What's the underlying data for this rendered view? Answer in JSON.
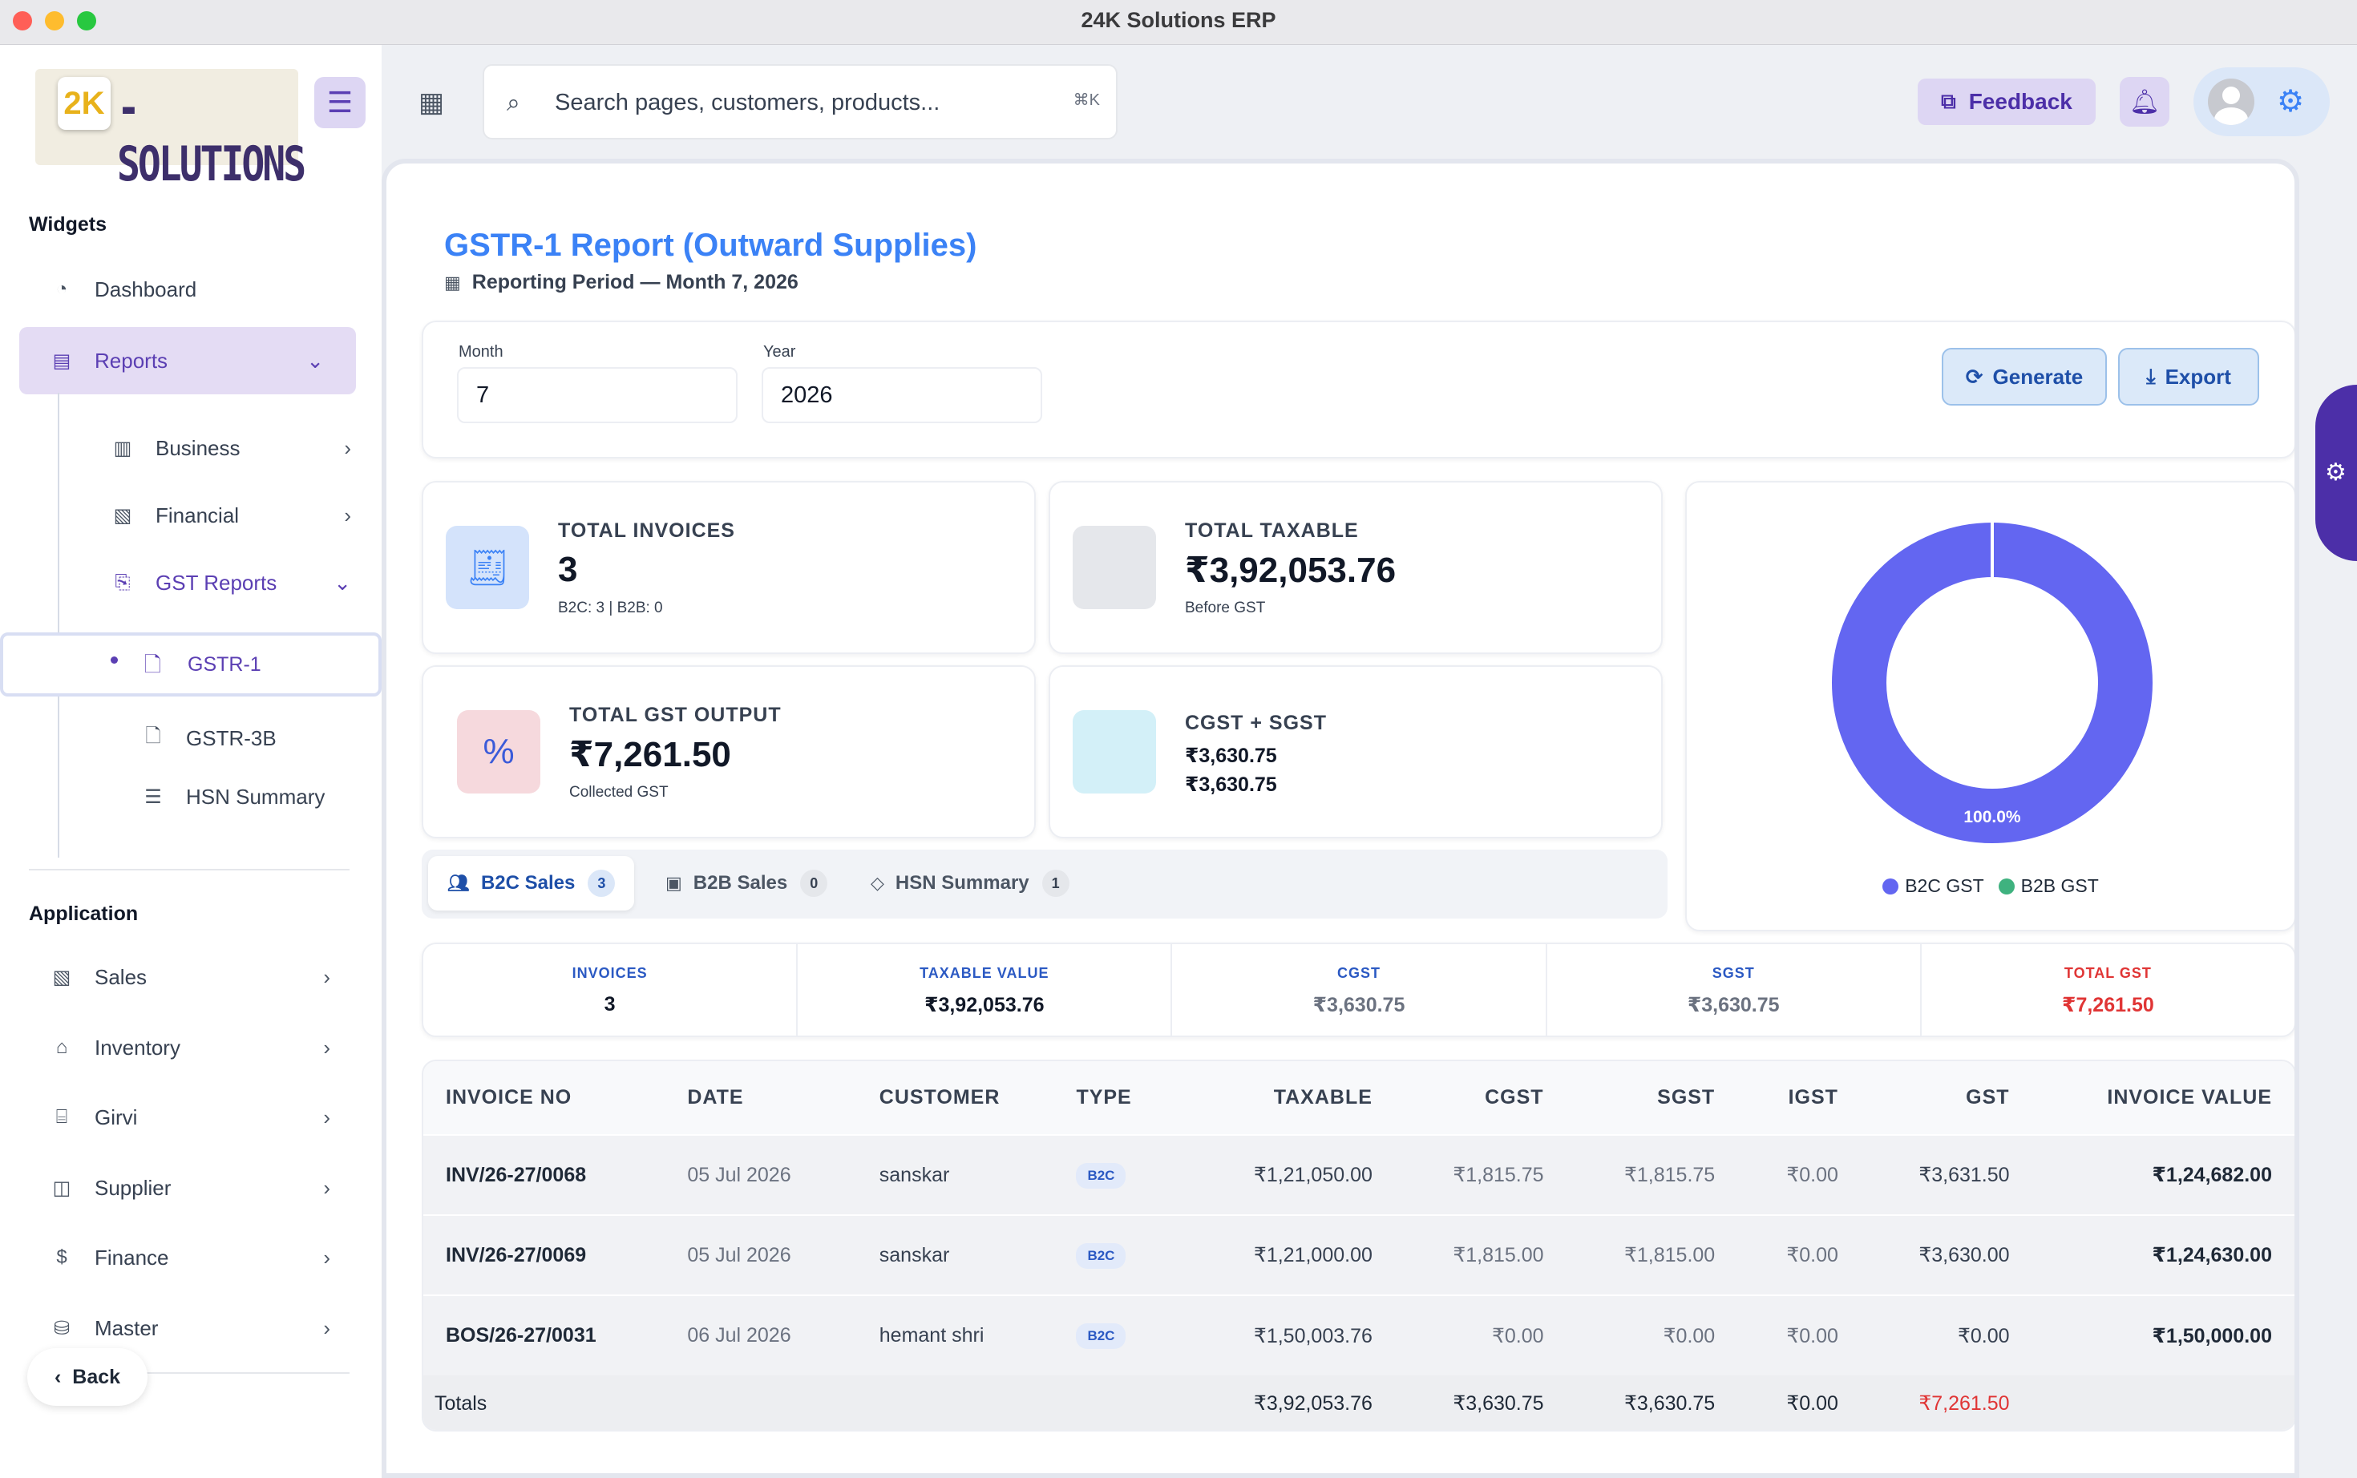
{
  "window": {
    "title": "24K Solutions ERP"
  },
  "brand": {
    "badge": "2K",
    "name": "-SOLUTIONS"
  },
  "header": {
    "search_placeholder": "Search pages, customers, products...",
    "search_shortcut": "⌘K",
    "feedback_label": "Feedback"
  },
  "sidebar": {
    "widgets_title": "Widgets",
    "dashboard": "Dashboard",
    "reports": "Reports",
    "business": "Business",
    "financial": "Financial",
    "gst_reports": "GST Reports",
    "gstr1": "GSTR-1",
    "gstr3b": "GSTR-3B",
    "hsn_summary": "HSN Summary",
    "application_title": "Application",
    "sales": "Sales",
    "inventory": "Inventory",
    "girvi": "Girvi",
    "supplier": "Supplier",
    "finance": "Finance",
    "master": "Master",
    "back": "Back"
  },
  "page": {
    "title": "GSTR-1 Report (Outward Supplies)",
    "period": "Reporting Period — Month 7, 2026"
  },
  "filters": {
    "month_label": "Month",
    "month_value": "7",
    "year_label": "Year",
    "year_value": "2026",
    "generate_label": "Generate",
    "export_label": "Export"
  },
  "stats": {
    "invoices": {
      "label": "TOTAL INVOICES",
      "value": "3",
      "sub": "B2C: 3 | B2B: 0"
    },
    "taxable": {
      "label": "TOTAL TAXABLE",
      "value": "₹3,92,053.76",
      "sub": "Before GST"
    },
    "gst_output": {
      "label": "TOTAL GST OUTPUT",
      "value": "₹7,261.50",
      "sub": "Collected GST"
    },
    "cgst_sgst": {
      "label": "CGST + SGST",
      "cgst": "₹3,630.75",
      "sgst": "₹3,630.75"
    }
  },
  "colors": {
    "b2c": "#6366f1",
    "b2b": "#3fb27f",
    "accent": "#3b82f6",
    "brand": "#4c2fa8"
  },
  "chart_data": {
    "type": "pie",
    "categories": [
      "B2C GST",
      "B2B GST"
    ],
    "values": [
      7261.5,
      0
    ],
    "data_labels": [
      "100.0%"
    ],
    "legend": "bottom"
  },
  "tabs": [
    {
      "label": "B2C Sales",
      "count": "3"
    },
    {
      "label": "B2B Sales",
      "count": "0"
    },
    {
      "label": "HSN Summary",
      "count": "1"
    }
  ],
  "summary": [
    {
      "label": "INVOICES",
      "value": "3"
    },
    {
      "label": "TAXABLE VALUE",
      "value": "₹3,92,053.76"
    },
    {
      "label": "CGST",
      "value": "₹3,630.75"
    },
    {
      "label": "SGST",
      "value": "₹3,630.75"
    },
    {
      "label": "TOTAL GST",
      "value": "₹7,261.50"
    }
  ],
  "table": {
    "headers": [
      "INVOICE NO",
      "DATE",
      "CUSTOMER",
      "TYPE",
      "TAXABLE",
      "CGST",
      "SGST",
      "IGST",
      "GST",
      "INVOICE VALUE"
    ],
    "rows": [
      [
        "INV/26-27/0068",
        "05 Jul 2026",
        "sanskar",
        "B2C",
        "₹1,21,050.00",
        "₹1,815.75",
        "₹1,815.75",
        "₹0.00",
        "₹3,631.50",
        "₹1,24,682.00"
      ],
      [
        "INV/26-27/0069",
        "05 Jul 2026",
        "sanskar",
        "B2C",
        "₹1,21,000.00",
        "₹1,815.00",
        "₹1,815.00",
        "₹0.00",
        "₹3,630.00",
        "₹1,24,630.00"
      ],
      [
        "BOS/26-27/0031",
        "06 Jul 2026",
        "hemant shri",
        "B2C",
        "₹1,50,003.76",
        "₹0.00",
        "₹0.00",
        "₹0.00",
        "₹0.00",
        "₹1,50,000.00"
      ]
    ],
    "totals": {
      "label": "Totals",
      "taxable": "₹3,92,053.76",
      "cgst": "₹3,630.75",
      "sgst": "₹3,630.75",
      "igst": "₹0.00",
      "gst": "₹7,261.50"
    }
  }
}
